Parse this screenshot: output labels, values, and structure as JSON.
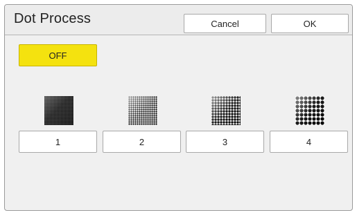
{
  "dialog": {
    "title": "Dot Process",
    "cancel_label": "Cancel",
    "ok_label": "OK",
    "off_label": "OFF",
    "off_color": "#f4e20f"
  },
  "options": [
    {
      "label": "1",
      "icon": "dot-fine-icon"
    },
    {
      "label": "2",
      "icon": "dot-medium-fine-icon"
    },
    {
      "label": "3",
      "icon": "dot-medium-coarse-icon"
    },
    {
      "label": "4",
      "icon": "dot-coarse-icon"
    }
  ]
}
